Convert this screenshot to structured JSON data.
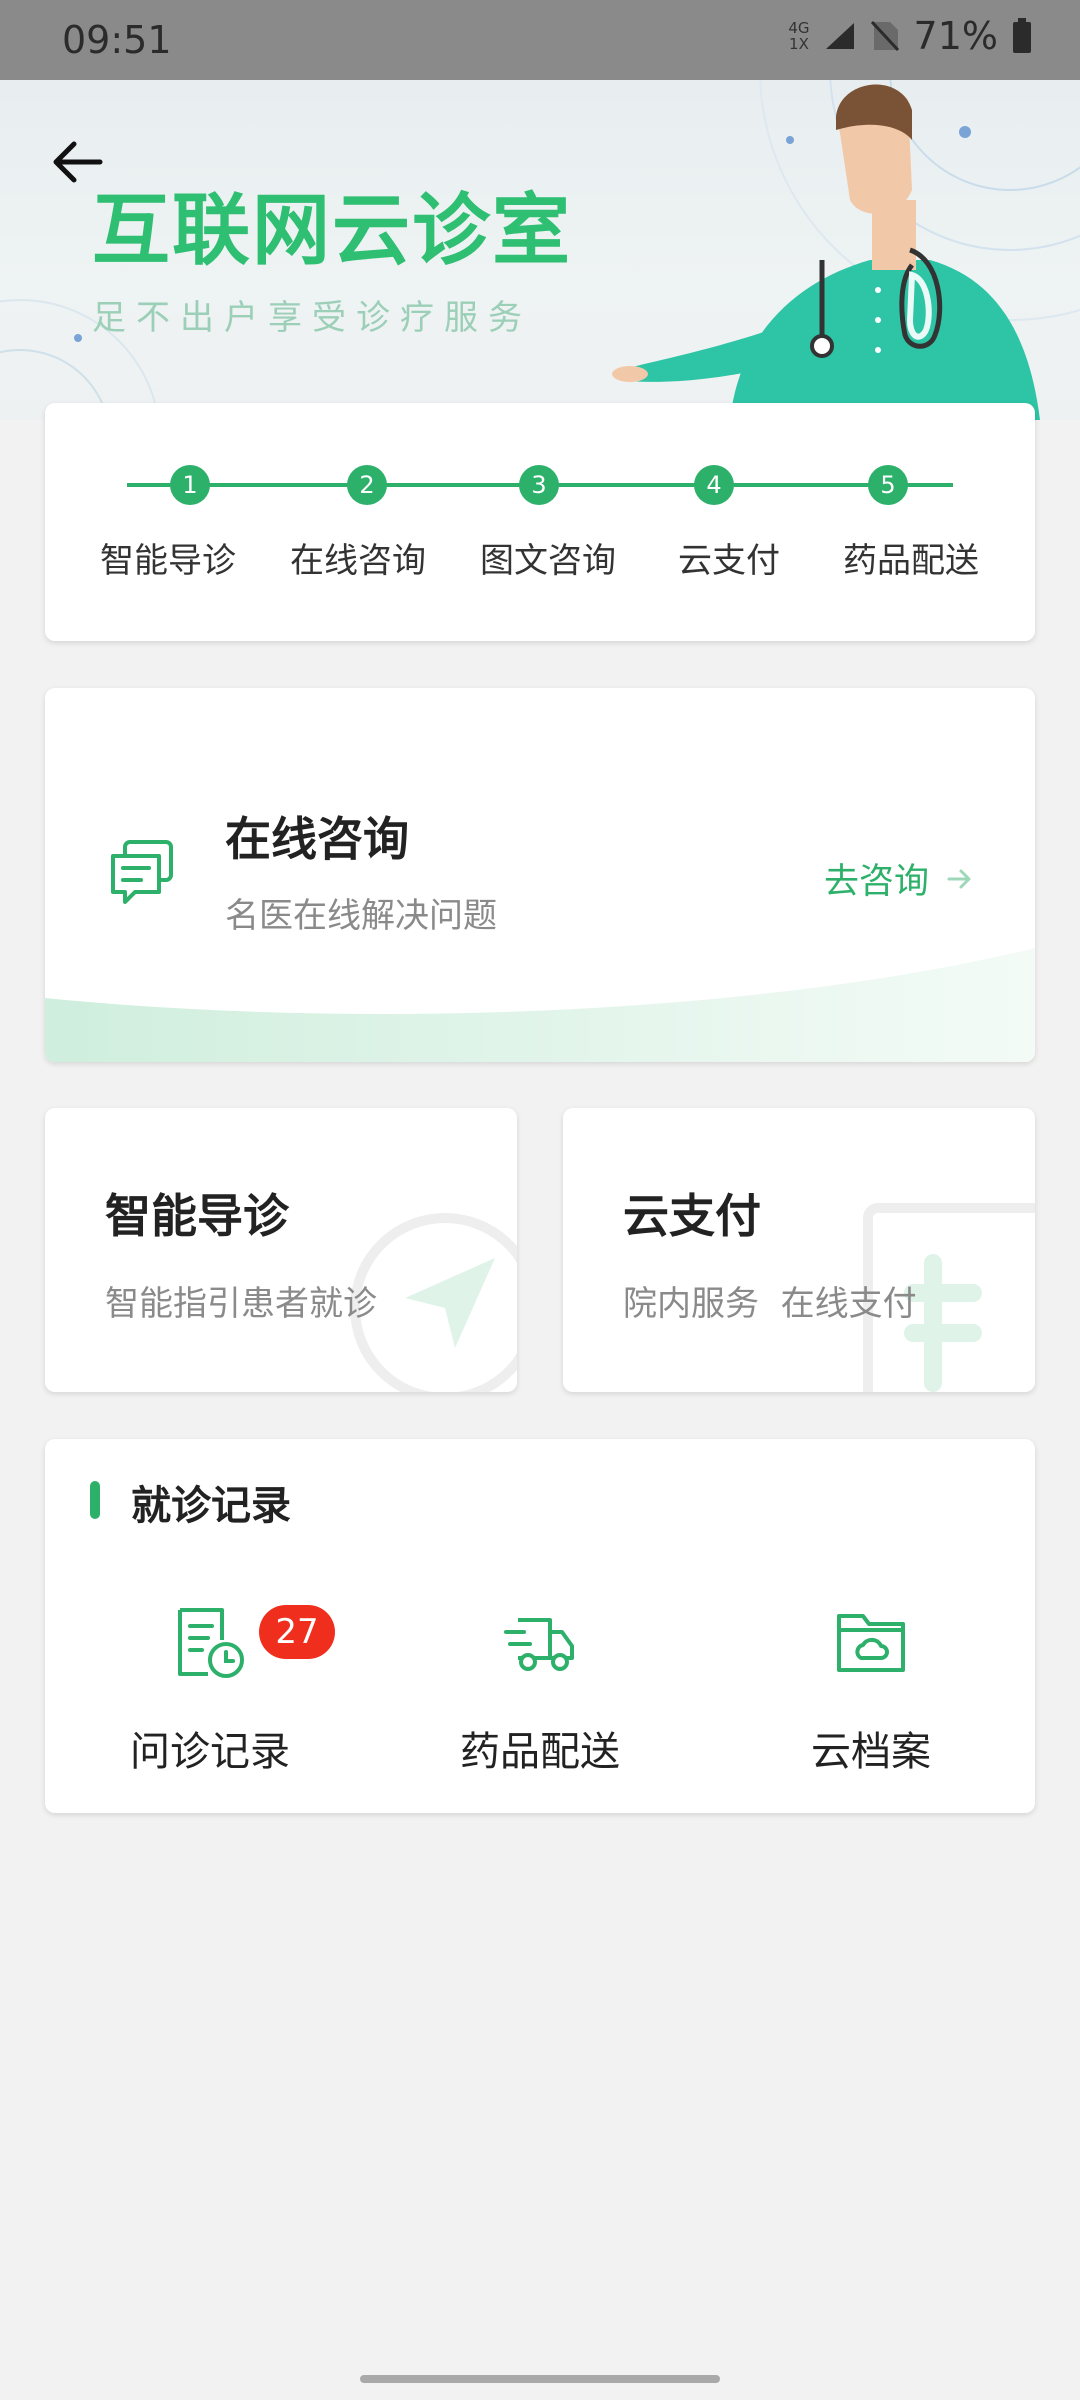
{
  "status_bar": {
    "time": "09:51",
    "network_top": "4G",
    "network_bottom": "1X",
    "battery": "71%"
  },
  "hero": {
    "title": "互联网云诊室",
    "subtitle": "足不出户享受诊疗服务"
  },
  "steps": [
    {
      "num": "1",
      "label": "智能导诊"
    },
    {
      "num": "2",
      "label": "在线咨询"
    },
    {
      "num": "3",
      "label": "图文咨询"
    },
    {
      "num": "4",
      "label": "云支付"
    },
    {
      "num": "5",
      "label": "药品配送"
    }
  ],
  "consult": {
    "title": "在线咨询",
    "subtitle": "名医在线解决问题",
    "link": "去咨询"
  },
  "guide": {
    "title": "智能导诊",
    "subtitle": "智能指引患者就诊"
  },
  "pay": {
    "title": "云支付",
    "subtitle": "院内服务  在线支付"
  },
  "records": {
    "title": "就诊记录",
    "items": [
      {
        "label": "问诊记录",
        "icon": "clipboard-clock-icon",
        "badge": "27"
      },
      {
        "label": "药品配送",
        "icon": "delivery-truck-icon"
      },
      {
        "label": "云档案",
        "icon": "cloud-folder-icon"
      }
    ]
  },
  "colors": {
    "accent": "#2db06a",
    "badge": "#f02e1e"
  }
}
